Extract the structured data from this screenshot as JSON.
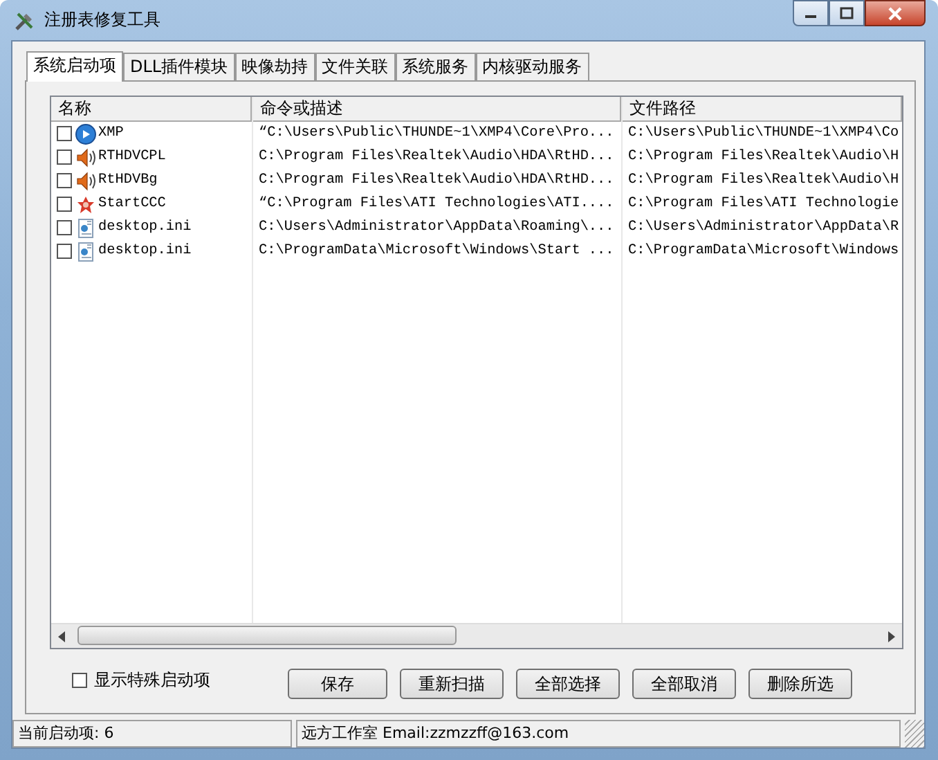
{
  "window": {
    "title": "注册表修复工具"
  },
  "tabs": [
    {
      "label": "系统启动项",
      "selected": true
    },
    {
      "label": "DLL插件模块",
      "selected": false
    },
    {
      "label": "映像劫持",
      "selected": false
    },
    {
      "label": "文件关联",
      "selected": false
    },
    {
      "label": "系统服务",
      "selected": false
    },
    {
      "label": "内核驱动服务",
      "selected": false
    }
  ],
  "table": {
    "columns": [
      "名称",
      "命令或描述",
      "文件路径"
    ],
    "rows": [
      {
        "kind": "app",
        "checked": false,
        "cells": [
          "XMP",
          "“C:\\Users\\Public\\THUNDE~1\\XMP4\\Core\\Pro...",
          "C:\\Users\\Public\\THUNDE~1\\XMP4\\Co"
        ]
      },
      {
        "kind": "audio",
        "checked": false,
        "cells": [
          "RTHDVCPL",
          "C:\\Program Files\\Realtek\\Audio\\HDA\\RtHD...",
          "C:\\Program Files\\Realtek\\Audio\\H"
        ]
      },
      {
        "kind": "audio",
        "checked": false,
        "cells": [
          "RtHDVBg",
          "C:\\Program Files\\Realtek\\Audio\\HDA\\RtHD...",
          "C:\\Program Files\\Realtek\\Audio\\H"
        ]
      },
      {
        "kind": "driver",
        "checked": false,
        "cells": [
          "StartCCC",
          "“C:\\Program Files\\ATI Technologies\\ATI....",
          "C:\\Program Files\\ATI Technologie"
        ]
      },
      {
        "kind": "config",
        "checked": false,
        "cells": [
          "desktop.ini",
          "C:\\Users\\Administrator\\AppData\\Roaming\\...",
          "C:\\Users\\Administrator\\AppData\\R"
        ]
      },
      {
        "kind": "config",
        "checked": false,
        "cells": [
          "desktop.ini",
          "C:\\ProgramData\\Microsoft\\Windows\\Start ...",
          "C:\\ProgramData\\Microsoft\\Windows"
        ]
      }
    ]
  },
  "show_special": {
    "label": "显示特殊启动项",
    "checked": false
  },
  "buttons": [
    "保存",
    "重新扫描",
    "全部选择",
    "全部取消",
    "删除所选"
  ],
  "status_bar": [
    "当前启动项: 6",
    "远方工作室  Email:zzmzzff@163.com"
  ]
}
